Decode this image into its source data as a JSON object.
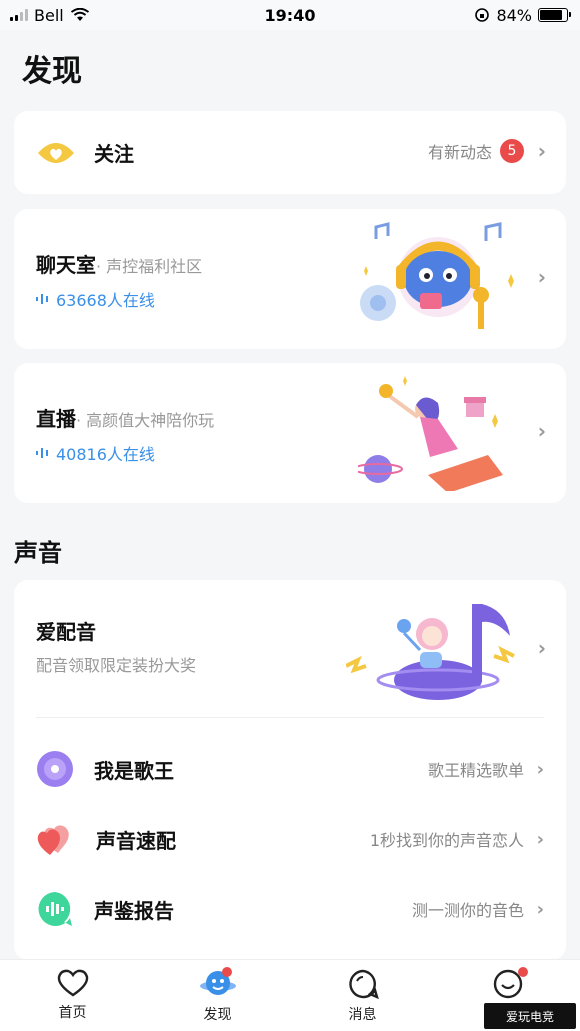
{
  "status_bar": {
    "carrier": "Bell",
    "time": "19:40",
    "battery": "84%",
    "battery_level": 0.84
  },
  "page": {
    "title": "发现"
  },
  "follow": {
    "label": "关注",
    "right_text": "有新动态",
    "badge": "5"
  },
  "chat_room": {
    "title": "聊天室",
    "subtitle": "· 声控福利社区",
    "online": "63668人在线"
  },
  "live": {
    "title": "直播",
    "subtitle": "· 高颜值大神陪你玩",
    "online": "40816人在线"
  },
  "voice_section": {
    "title": "声音"
  },
  "dubbing": {
    "title": "爱配音",
    "subtitle": "配音领取限定装扮大奖"
  },
  "rows": [
    {
      "label": "我是歌王",
      "right": "歌王精选歌单",
      "icon": "disc-icon"
    },
    {
      "label": "声音速配",
      "right": "1秒找到你的声音恋人",
      "icon": "hearts-icon"
    },
    {
      "label": "声鉴报告",
      "right": "测一测你的音色",
      "icon": "voice-wave-icon"
    }
  ],
  "tabs": [
    {
      "label": "首页",
      "icon": "heart-icon",
      "dot": false
    },
    {
      "label": "发现",
      "icon": "planet-icon",
      "dot": true,
      "active": true
    },
    {
      "label": "消息",
      "icon": "chat-bubble-icon",
      "dot": false
    },
    {
      "label": "",
      "icon": "smile-icon",
      "dot": true
    }
  ],
  "watermark": {
    "text": "爱玩电竞"
  },
  "colors": {
    "accent_blue": "#3a8fe8",
    "badge_red": "#e94b4b",
    "follow_yellow": "#f5c842"
  }
}
